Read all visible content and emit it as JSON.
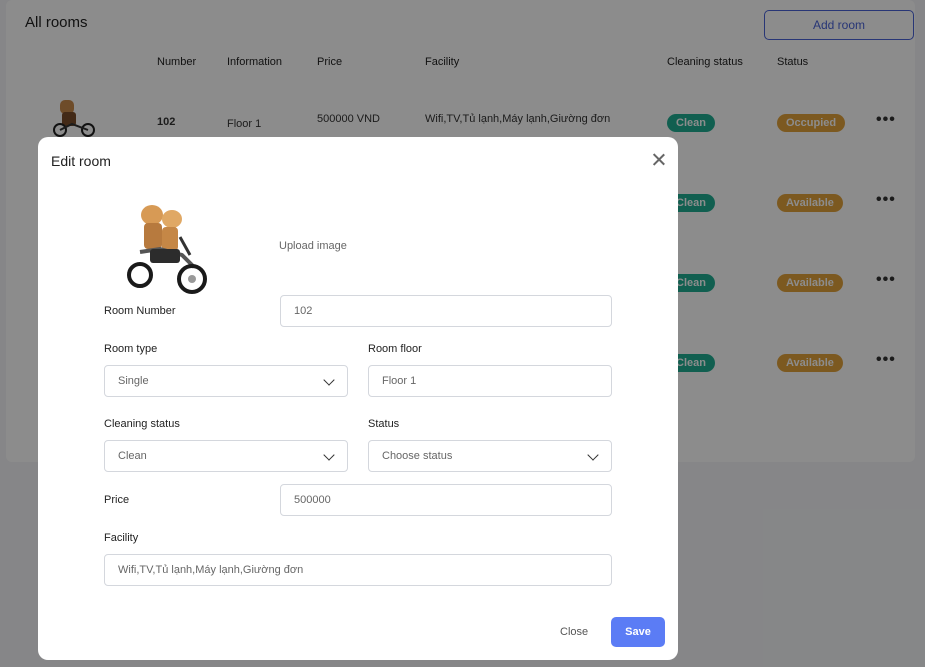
{
  "page": {
    "title": "All rooms",
    "add_button": "Add room",
    "columns": [
      "Number",
      "Information",
      "Price",
      "Facility",
      "Cleaning status",
      "Status"
    ],
    "rows": [
      {
        "number": "102",
        "information": "Floor 1",
        "price": "500000 VND",
        "facility": "Wifi,TV,Tủ lạnh,Máy lạnh,Giường đơn",
        "cleaning": "Clean",
        "status": "Occupied"
      },
      {
        "cleaning": "Clean",
        "status": "Available"
      },
      {
        "cleaning": "Clean",
        "status": "Available"
      },
      {
        "cleaning": "Clean",
        "status": "Available"
      }
    ],
    "more_icon": "ellipsis-icon"
  },
  "modal": {
    "title": "Edit room",
    "upload_label": "Upload image",
    "room_number": {
      "label": "Room Number",
      "value": "102"
    },
    "room_type": {
      "label": "Room type",
      "value": "Single"
    },
    "room_floor": {
      "label": "Room floor",
      "value": "Floor 1"
    },
    "cleaning_status": {
      "label": "Cleaning status",
      "value": "Clean"
    },
    "status": {
      "label": "Status",
      "placeholder": "Choose status"
    },
    "price": {
      "label": "Price",
      "value": "500000"
    },
    "facility": {
      "label": "Facility",
      "value": "Wifi,TV,Tủ lạnh,Máy lạnh,Giường đơn"
    },
    "close_label": "Close",
    "save_label": "Save"
  },
  "colors": {
    "primary": "#5b7cf5",
    "clean": "#1fae93",
    "status": "#e2a23b"
  }
}
